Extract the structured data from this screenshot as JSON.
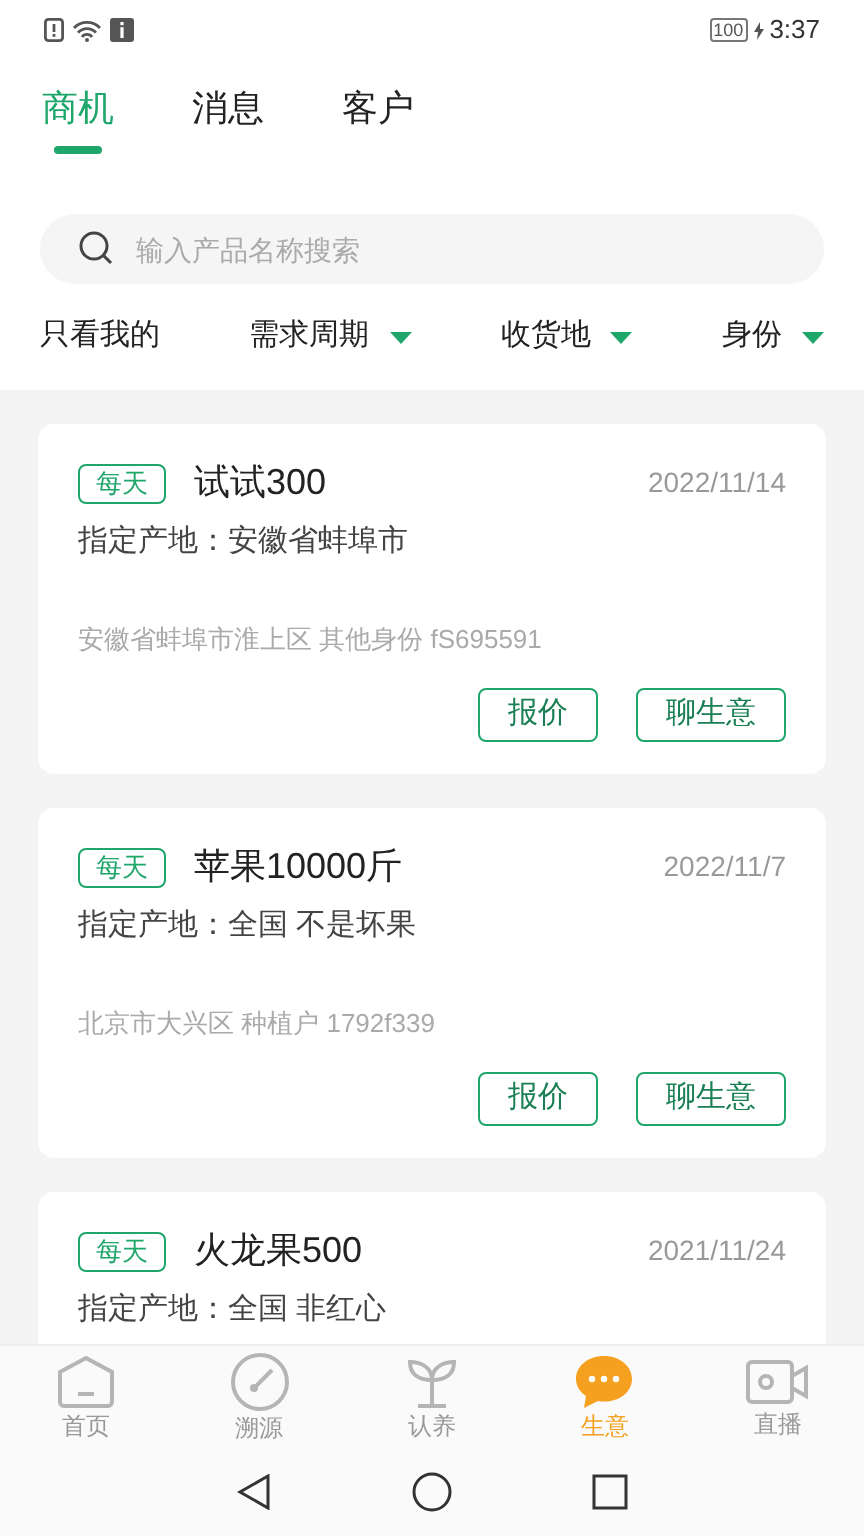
{
  "status_bar": {
    "battery": "100",
    "time": "3:37"
  },
  "tabs": [
    {
      "label": "商机",
      "selected": true
    },
    {
      "label": "消息",
      "selected": false
    },
    {
      "label": "客户",
      "selected": false
    }
  ],
  "search": {
    "placeholder": "输入产品名称搜索"
  },
  "filters": [
    {
      "label": "只看我的",
      "kind": "toggle"
    },
    {
      "label": "需求周期",
      "kind": "dropdown"
    },
    {
      "label": "收货地",
      "kind": "dropdown"
    },
    {
      "label": "身份",
      "kind": "dropdown"
    }
  ],
  "cards": [
    {
      "tag": "每天",
      "title": "试试300",
      "date": "2022/11/14",
      "origin": "指定产地：安徽省蚌埠市",
      "location": "安徽省蚌埠市淮上区 其他身份 fS695591",
      "buttons": [
        "报价",
        "聊生意"
      ]
    },
    {
      "tag": "每天",
      "title": "苹果10000斤",
      "date": "2022/11/7",
      "origin": "指定产地：全国 不是坏果",
      "location": "北京市大兴区 种植户 1792f339",
      "buttons": [
        "报价",
        "聊生意"
      ]
    },
    {
      "tag": "每天",
      "title": "火龙果500",
      "date": "2021/11/24",
      "origin": "指定产地：全国 非红心"
    }
  ],
  "bottom_nav": [
    {
      "label": "首页",
      "kind": "home",
      "selected": false
    },
    {
      "label": "溯源",
      "kind": "gauge",
      "selected": false
    },
    {
      "label": "认养",
      "kind": "sprout",
      "selected": false
    },
    {
      "label": "生意",
      "kind": "chat",
      "selected": true
    },
    {
      "label": "直播",
      "kind": "camera",
      "selected": false
    }
  ]
}
